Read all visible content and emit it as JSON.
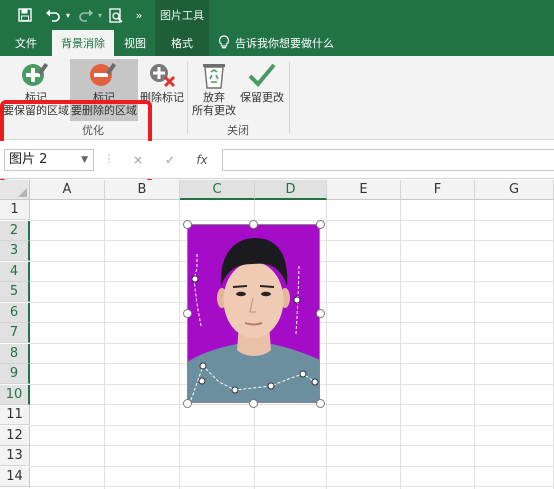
{
  "titlebar": {
    "picture_tools": "图片工具"
  },
  "tabs": [
    {
      "label": "文件"
    },
    {
      "label": "背景消除"
    },
    {
      "label": "视图"
    },
    {
      "label": "格式"
    }
  ],
  "tell_me": {
    "text": "告诉我你想要做什么"
  },
  "ribbon": {
    "mark_keep": {
      "line1": "标记",
      "line2": "要保留的区域"
    },
    "mark_remove": {
      "line1": "标记",
      "line2": "要删除的区域"
    },
    "delete_mark": {
      "label": "删除标记"
    },
    "discard": {
      "line1": "放弃",
      "line2": "所有更改"
    },
    "keep_changes": {
      "label": "保留更改"
    },
    "group_optimize": "优化",
    "group_close": "关闭"
  },
  "formula_bar": {
    "name_box": "图片 2",
    "fx": "fx",
    "cancel": "×",
    "enter": "✓",
    "formula_value": ""
  },
  "grid": {
    "columns": [
      "A",
      "B",
      "C",
      "D",
      "E",
      "F",
      "G"
    ],
    "rows": [
      "1",
      "2",
      "3",
      "4",
      "5",
      "6",
      "7",
      "8",
      "9",
      "10",
      "11",
      "12",
      "13",
      "14"
    ]
  },
  "colors": {
    "brand": "#217346",
    "picture_background": "#a50cc8",
    "highlight_frame": "#ee1c1c"
  }
}
